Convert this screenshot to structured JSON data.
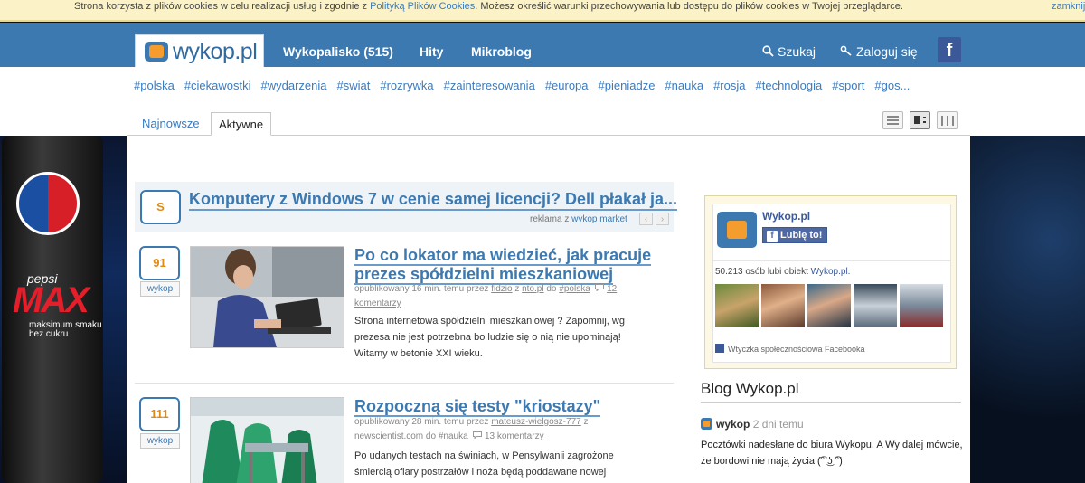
{
  "cookie": {
    "text_before": "Strona korzysta z plików cookies w celu realizacji usług i zgodnie z ",
    "policy_link": "Polityką Plików Cookies",
    "text_after": ". Możesz określić warunki przechowywania lub dostępu do plików cookies w Twojej przeglądarce.",
    "close": "zamknij"
  },
  "header": {
    "logo": "wykop.pl",
    "nav": [
      {
        "label": "Wykopalisko (515)"
      },
      {
        "label": "Hity"
      },
      {
        "label": "Mikroblog"
      }
    ],
    "search": "Szukaj",
    "login": "Zaloguj się",
    "facebook": "f"
  },
  "tags": [
    "#polska",
    "#ciekawostki",
    "#wydarzenia",
    "#swiat",
    "#rozrywka",
    "#zainteresowania",
    "#europa",
    "#pieniadze",
    "#nauka",
    "#rosja",
    "#technologia",
    "#sport",
    "#gos..."
  ],
  "tabs": {
    "newest": "Najnowsze",
    "active": "Aktywne"
  },
  "ad": {
    "brand": "pepsi",
    "product": "MAX",
    "tagline1": "maksimum smaku",
    "tagline2": "bez cukru"
  },
  "promo": {
    "votes": "S",
    "title": "Komputery z Windows 7 w cenie samej licencji? Dell płakał ja...",
    "meta_prefix": "reklama z",
    "meta_link": "wykop market",
    "prev": "‹",
    "next": "›"
  },
  "entries": [
    {
      "votes": "91",
      "button": "wykop",
      "title": "Po co lokator ma wiedzieć, jak pracuje prezes spółdzielni mieszkaniowej",
      "meta_published": "opublikowany 16 min. temu przez",
      "author": "fidzio",
      "meta_from": "z",
      "source": "nto.pl",
      "meta_to": "do",
      "tag": "#polska",
      "comments": "12 komentarzy",
      "description": "Strona internetowa spółdzielni mieszkaniowej ? Zapomnij, wg prezesa nie jest potrzebna bo ludzie się o nią nie upominają! Witamy w betonie XXI wieku."
    },
    {
      "votes": "111",
      "button": "wykop",
      "title": "Rozpoczną się testy \"kriostazy\"",
      "meta_published": "opublikowany 28 min. temu przez",
      "author": "mateusz-wielgosz-777",
      "meta_from": "z",
      "source": "newscientist.com",
      "meta_to": "do",
      "tag": "#nauka",
      "comments": "13 komentarzy",
      "description": "Po udanych testach na świniach, w Pensylwanii zagrożone śmiercią ofiary postrzałów i noża będą poddawane nowej"
    }
  ],
  "facebook_box": {
    "name": "Wykop.pl",
    "like": "Lubię to!",
    "count_text": "50.213 osób lubi obiekt",
    "count_link": "Wykop.pl.",
    "plugin": "Wtyczka społecznościowa Facebooka"
  },
  "blog": {
    "heading": "Blog Wykop.pl",
    "author": "wykop",
    "time": "2 dni temu",
    "text": "Pocztówki nadesłane do biura Wykopu. A Wy dalej mówcie, że bordowi nie mają życia (͡° ͜ʖ ͡°)"
  },
  "colors": {
    "brand_blue": "#3c79b1",
    "brand_orange": "#f49d2e",
    "facebook": "#3b5998"
  }
}
